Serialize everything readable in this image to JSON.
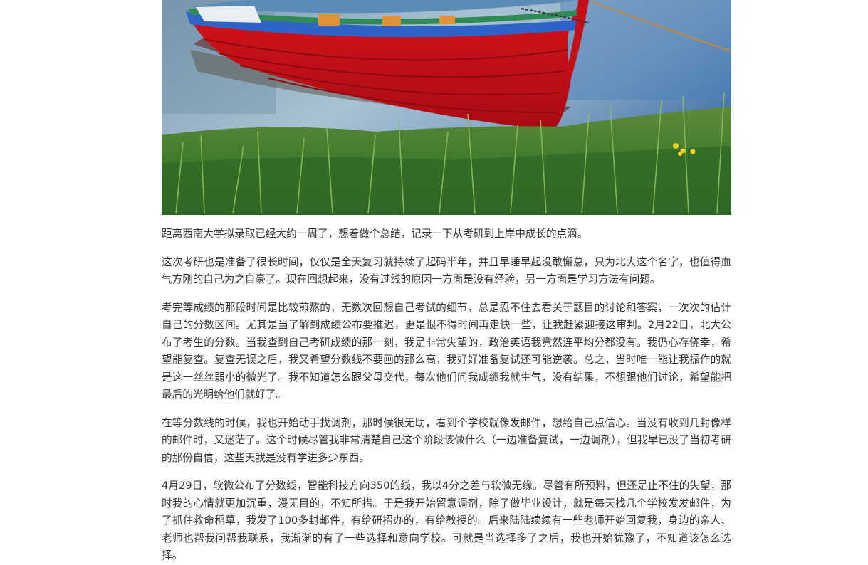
{
  "article": {
    "hero_image": {
      "subject": "red-rowboat-on-lake-with-grass"
    },
    "paragraphs": [
      "距离西南大学拟录取已经大约一周了，想着做个总结，记录一下从考研到上岸中成长的点滴。",
      "这次考研也是准备了很长时间，仅仅是全天复习就持续了起码半年，并且早睡早起没敢懈怠，只为北大这个名字，也值得血气方刚的自己为之自豪了。现在回想起来，没有过线的原因一方面是没有经验，另一方面是学习方法有问题。",
      "考完等成绩的那段时间是比较煎熬的，无数次回想自己考试的细节，总是忍不住去看关于题目的讨论和答案，一次次的估计自己的分数区间。尤其是当了解到成绩公布要推迟，更是恨不得时间再走快一些，让我赶紧迎接这审判。2月22日，北大公布了考生的分数。当我查到自己考研成绩的那一刻，我是非常失望的，政治英语我竟然连平均分都没有。我仍心存侥幸，希望能复查。复查无误之后，我又希望分数线不要画的那么高，我好好准备复试还可能逆袭。总之，当时唯一能让我振作的就是这一丝丝弱小的微光了。我不知道怎么跟父母交代，每次他们问我成绩我就生气，没有结果，不想跟他们讨论，希望能把最后的光明给他们就好了。",
      "在等分数线的时候，我也开始动手找调剂，那时候很无助，看到个学校就像发邮件，想给自己点信心。当没有收到几封像样的邮件时，又迷茫了。这个时候尽管我非常清楚自己这个阶段该做什么（一边准备复试，一边调剂），但我早已没了当初考研的那份自信，这些天我是没有学进多少东西。",
      "4月29日，软微公布了分数线，智能科技方向350的线，我以4分之差与软微无缘。尽管有所预料，但还是止不住的失望，那时我的心情就更加沉重，漫无目的，不知所措。于是我开始留意调剂，除了做毕业设计，就是每天找几个学校发发邮件，为了抓住救命稻草，我发了100多封邮件，有给研招办的，有给教授的。后来陆陆续续有一些老师开始回复我，身边的亲人、老师也帮我问帮我联系，我渐渐的有了一些选择和意向学校。可就是当选择多了之后，我也开始犹豫了，不知道该怎么选择。"
    ]
  }
}
